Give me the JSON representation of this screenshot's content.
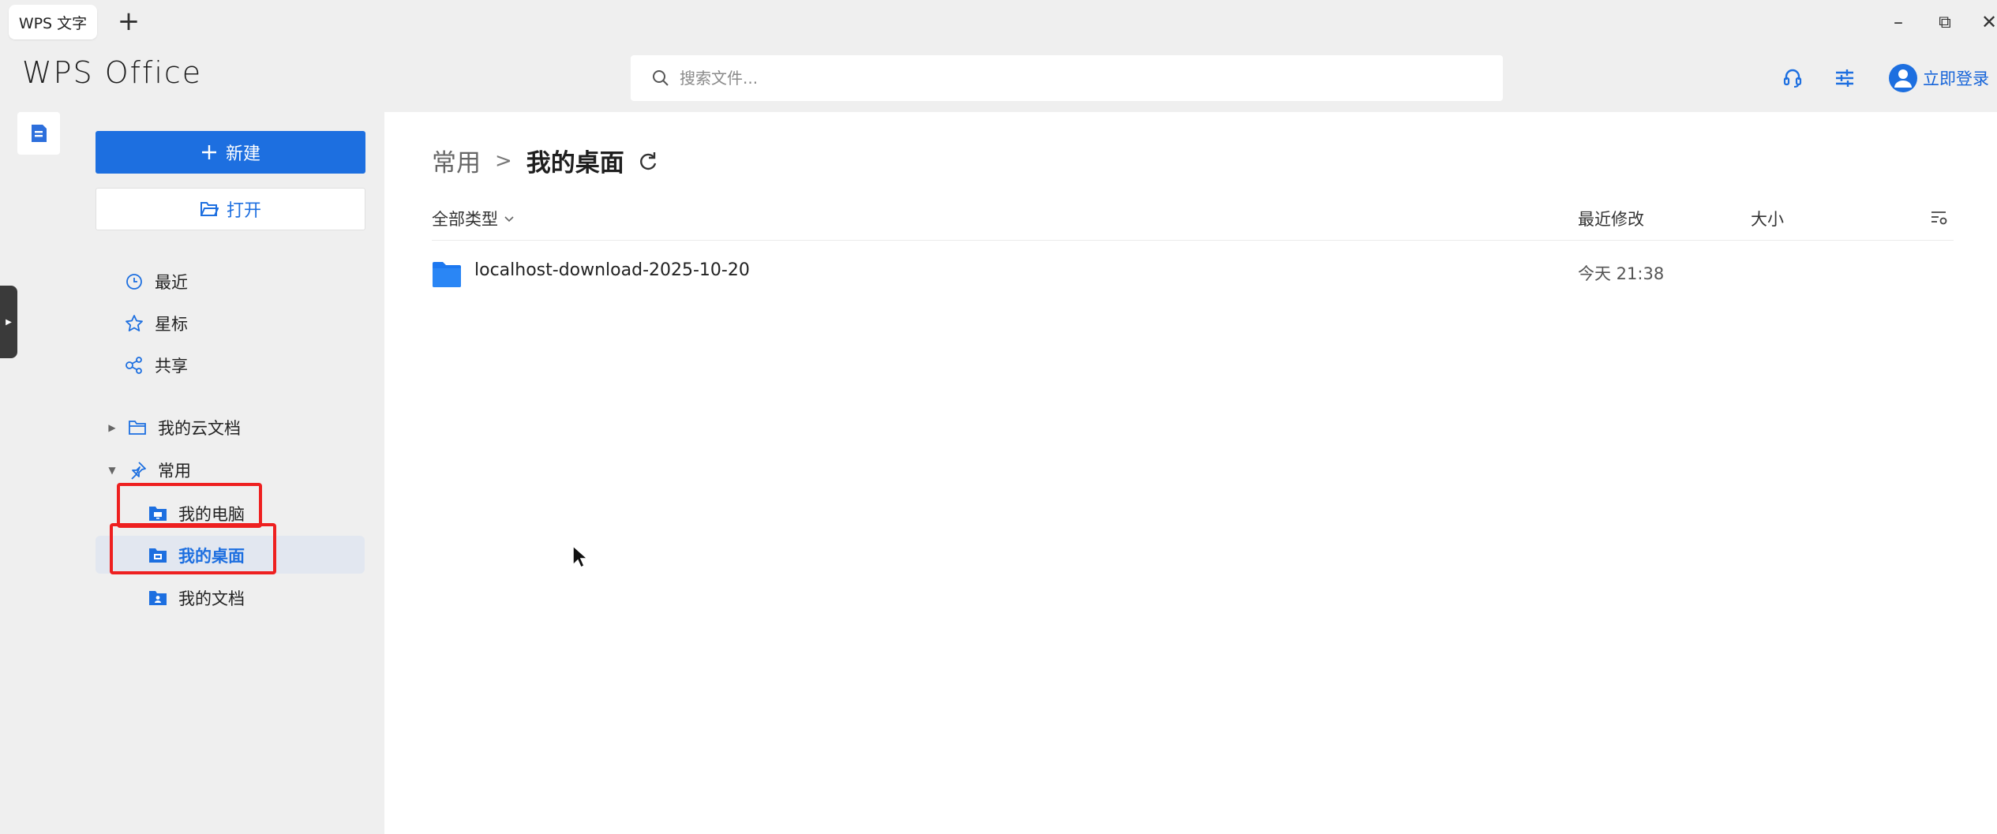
{
  "tab": {
    "title": "WPS 文字",
    "new_tab": "+"
  },
  "window": {
    "minimize": "–",
    "restore": "⧉",
    "close": "✕"
  },
  "header": {
    "logo": "WPS Office",
    "search_placeholder": "搜索文件...",
    "login_label": "立即登录",
    "icons": [
      "headset-icon",
      "settings-sliders-icon",
      "user-avatar-icon"
    ]
  },
  "sidebar": {
    "new_label": "新建",
    "open_label": "打开",
    "quick": [
      {
        "label": "最近",
        "icon": "clock-icon"
      },
      {
        "label": "星标",
        "icon": "star-icon"
      },
      {
        "label": "共享",
        "icon": "share-icon"
      }
    ],
    "cloud": {
      "label": "我的云文档",
      "icon": "folder-icon",
      "expanded": false
    },
    "common": {
      "label": "常用",
      "icon": "pin-icon",
      "expanded": true,
      "items": [
        {
          "label": "我的电脑",
          "icon": "computer-folder-icon"
        },
        {
          "label": "我的桌面",
          "icon": "desktop-folder-icon",
          "selected": true
        },
        {
          "label": "我的文档",
          "icon": "documents-folder-icon"
        }
      ]
    }
  },
  "main": {
    "breadcrumb": {
      "parent": "常用",
      "separator": ">",
      "current": "我的桌面"
    },
    "columns": {
      "type_filter": "全部类型",
      "modified": "最近修改",
      "size": "大小"
    },
    "files": [
      {
        "name": "localhost-download-2025-10-20",
        "modified": "今天 21:38",
        "size": "",
        "icon": "folder-icon"
      }
    ]
  },
  "colors": {
    "accent": "#1d6fe0",
    "highlight_box": "#ee2020",
    "selected_row": "#e2e7f0"
  }
}
